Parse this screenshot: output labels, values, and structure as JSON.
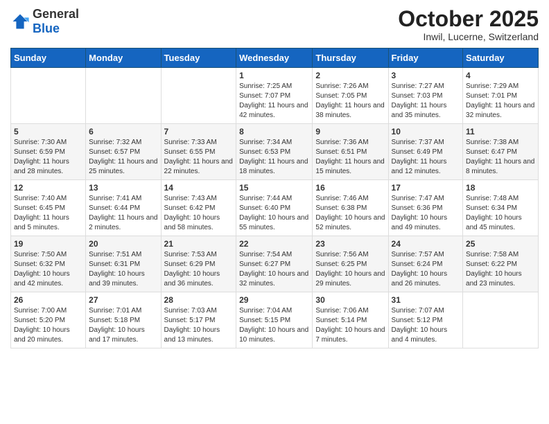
{
  "header": {
    "logo_general": "General",
    "logo_blue": "Blue",
    "month_title": "October 2025",
    "subtitle": "Inwil, Lucerne, Switzerland"
  },
  "days_of_week": [
    "Sunday",
    "Monday",
    "Tuesday",
    "Wednesday",
    "Thursday",
    "Friday",
    "Saturday"
  ],
  "weeks": [
    [
      {
        "num": "",
        "sunrise": "",
        "sunset": "",
        "daylight": ""
      },
      {
        "num": "",
        "sunrise": "",
        "sunset": "",
        "daylight": ""
      },
      {
        "num": "",
        "sunrise": "",
        "sunset": "",
        "daylight": ""
      },
      {
        "num": "1",
        "sunrise": "Sunrise: 7:25 AM",
        "sunset": "Sunset: 7:07 PM",
        "daylight": "Daylight: 11 hours and 42 minutes."
      },
      {
        "num": "2",
        "sunrise": "Sunrise: 7:26 AM",
        "sunset": "Sunset: 7:05 PM",
        "daylight": "Daylight: 11 hours and 38 minutes."
      },
      {
        "num": "3",
        "sunrise": "Sunrise: 7:27 AM",
        "sunset": "Sunset: 7:03 PM",
        "daylight": "Daylight: 11 hours and 35 minutes."
      },
      {
        "num": "4",
        "sunrise": "Sunrise: 7:29 AM",
        "sunset": "Sunset: 7:01 PM",
        "daylight": "Daylight: 11 hours and 32 minutes."
      }
    ],
    [
      {
        "num": "5",
        "sunrise": "Sunrise: 7:30 AM",
        "sunset": "Sunset: 6:59 PM",
        "daylight": "Daylight: 11 hours and 28 minutes."
      },
      {
        "num": "6",
        "sunrise": "Sunrise: 7:32 AM",
        "sunset": "Sunset: 6:57 PM",
        "daylight": "Daylight: 11 hours and 25 minutes."
      },
      {
        "num": "7",
        "sunrise": "Sunrise: 7:33 AM",
        "sunset": "Sunset: 6:55 PM",
        "daylight": "Daylight: 11 hours and 22 minutes."
      },
      {
        "num": "8",
        "sunrise": "Sunrise: 7:34 AM",
        "sunset": "Sunset: 6:53 PM",
        "daylight": "Daylight: 11 hours and 18 minutes."
      },
      {
        "num": "9",
        "sunrise": "Sunrise: 7:36 AM",
        "sunset": "Sunset: 6:51 PM",
        "daylight": "Daylight: 11 hours and 15 minutes."
      },
      {
        "num": "10",
        "sunrise": "Sunrise: 7:37 AM",
        "sunset": "Sunset: 6:49 PM",
        "daylight": "Daylight: 11 hours and 12 minutes."
      },
      {
        "num": "11",
        "sunrise": "Sunrise: 7:38 AM",
        "sunset": "Sunset: 6:47 PM",
        "daylight": "Daylight: 11 hours and 8 minutes."
      }
    ],
    [
      {
        "num": "12",
        "sunrise": "Sunrise: 7:40 AM",
        "sunset": "Sunset: 6:45 PM",
        "daylight": "Daylight: 11 hours and 5 minutes."
      },
      {
        "num": "13",
        "sunrise": "Sunrise: 7:41 AM",
        "sunset": "Sunset: 6:44 PM",
        "daylight": "Daylight: 11 hours and 2 minutes."
      },
      {
        "num": "14",
        "sunrise": "Sunrise: 7:43 AM",
        "sunset": "Sunset: 6:42 PM",
        "daylight": "Daylight: 10 hours and 58 minutes."
      },
      {
        "num": "15",
        "sunrise": "Sunrise: 7:44 AM",
        "sunset": "Sunset: 6:40 PM",
        "daylight": "Daylight: 10 hours and 55 minutes."
      },
      {
        "num": "16",
        "sunrise": "Sunrise: 7:46 AM",
        "sunset": "Sunset: 6:38 PM",
        "daylight": "Daylight: 10 hours and 52 minutes."
      },
      {
        "num": "17",
        "sunrise": "Sunrise: 7:47 AM",
        "sunset": "Sunset: 6:36 PM",
        "daylight": "Daylight: 10 hours and 49 minutes."
      },
      {
        "num": "18",
        "sunrise": "Sunrise: 7:48 AM",
        "sunset": "Sunset: 6:34 PM",
        "daylight": "Daylight: 10 hours and 45 minutes."
      }
    ],
    [
      {
        "num": "19",
        "sunrise": "Sunrise: 7:50 AM",
        "sunset": "Sunset: 6:32 PM",
        "daylight": "Daylight: 10 hours and 42 minutes."
      },
      {
        "num": "20",
        "sunrise": "Sunrise: 7:51 AM",
        "sunset": "Sunset: 6:31 PM",
        "daylight": "Daylight: 10 hours and 39 minutes."
      },
      {
        "num": "21",
        "sunrise": "Sunrise: 7:53 AM",
        "sunset": "Sunset: 6:29 PM",
        "daylight": "Daylight: 10 hours and 36 minutes."
      },
      {
        "num": "22",
        "sunrise": "Sunrise: 7:54 AM",
        "sunset": "Sunset: 6:27 PM",
        "daylight": "Daylight: 10 hours and 32 minutes."
      },
      {
        "num": "23",
        "sunrise": "Sunrise: 7:56 AM",
        "sunset": "Sunset: 6:25 PM",
        "daylight": "Daylight: 10 hours and 29 minutes."
      },
      {
        "num": "24",
        "sunrise": "Sunrise: 7:57 AM",
        "sunset": "Sunset: 6:24 PM",
        "daylight": "Daylight: 10 hours and 26 minutes."
      },
      {
        "num": "25",
        "sunrise": "Sunrise: 7:58 AM",
        "sunset": "Sunset: 6:22 PM",
        "daylight": "Daylight: 10 hours and 23 minutes."
      }
    ],
    [
      {
        "num": "26",
        "sunrise": "Sunrise: 7:00 AM",
        "sunset": "Sunset: 5:20 PM",
        "daylight": "Daylight: 10 hours and 20 minutes."
      },
      {
        "num": "27",
        "sunrise": "Sunrise: 7:01 AM",
        "sunset": "Sunset: 5:18 PM",
        "daylight": "Daylight: 10 hours and 17 minutes."
      },
      {
        "num": "28",
        "sunrise": "Sunrise: 7:03 AM",
        "sunset": "Sunset: 5:17 PM",
        "daylight": "Daylight: 10 hours and 13 minutes."
      },
      {
        "num": "29",
        "sunrise": "Sunrise: 7:04 AM",
        "sunset": "Sunset: 5:15 PM",
        "daylight": "Daylight: 10 hours and 10 minutes."
      },
      {
        "num": "30",
        "sunrise": "Sunrise: 7:06 AM",
        "sunset": "Sunset: 5:14 PM",
        "daylight": "Daylight: 10 hours and 7 minutes."
      },
      {
        "num": "31",
        "sunrise": "Sunrise: 7:07 AM",
        "sunset": "Sunset: 5:12 PM",
        "daylight": "Daylight: 10 hours and 4 minutes."
      },
      {
        "num": "",
        "sunrise": "",
        "sunset": "",
        "daylight": ""
      }
    ]
  ]
}
